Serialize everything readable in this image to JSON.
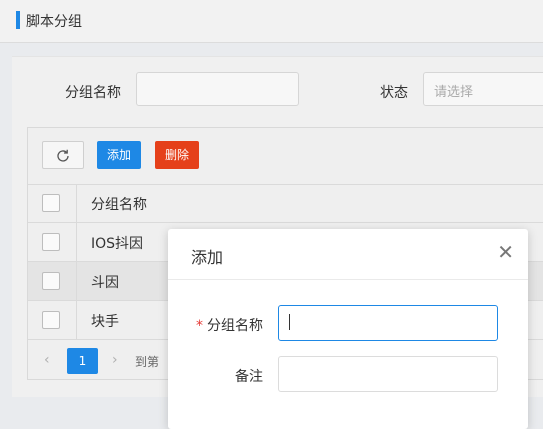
{
  "header": {
    "title": "脚本分组"
  },
  "search": {
    "group_name_label": "分组名称",
    "status_label": "状态",
    "status_placeholder": "请选择"
  },
  "toolbar": {
    "refresh_icon": "refresh-icon",
    "add_label": "添加",
    "delete_label": "删除"
  },
  "table": {
    "header": "分组名称",
    "rows": [
      "IOS抖因",
      "斗因",
      "块手"
    ]
  },
  "pager": {
    "prev": "‹",
    "page": "1",
    "next": "›",
    "goto_label": "到第"
  },
  "modal": {
    "title": "添加",
    "close": "✕",
    "required_mark": "*",
    "group_name_label": "分组名称",
    "remark_label": "备注"
  },
  "colors": {
    "primary": "#1e88e5",
    "danger": "#e5401a"
  }
}
